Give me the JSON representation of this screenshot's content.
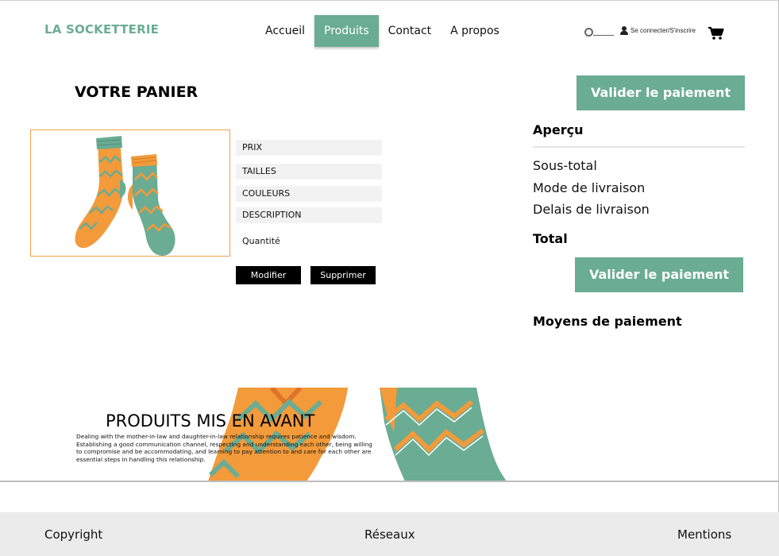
{
  "header": {
    "logo": "LA SOCKETTERIE",
    "nav": [
      "Accueil",
      "Produits",
      "Contact",
      "A propos"
    ],
    "active_nav": "Produits",
    "login_label": "Se connecter/S'inscrire"
  },
  "cart": {
    "title": "VOTRE PANIER",
    "item": {
      "price_label": "PRIX",
      "sizes_label": "TAILLES",
      "colors_label": "COULEURS",
      "description_label": "DESCRIPTION",
      "quantity_label": "Quantité",
      "edit_label": "Modifier",
      "remove_label": "Supprimer"
    }
  },
  "summary": {
    "pay_button": "Valider le paiement",
    "overview_title": "Aperçu",
    "subtotal": "Sous-total",
    "delivery_mode": "Mode de livraison",
    "delivery_time": "Delais de livraison",
    "total": "Total",
    "payment_methods": "Moyens de paiement"
  },
  "featured": {
    "title": "PRODUITS MIS EN AVANT",
    "text": "Dealing with the mother-in-law and daughter-in-law relationship requires patience and wisdom. Establishing a good communication channel, respecting and understanding each other, being willing to compromise and be accommodating, and learning to pay attention to and care for each other are essential steps in handling this relationship."
  },
  "footer": {
    "copyright": "Copyright",
    "social": "Réseaux",
    "legal": "Mentions"
  },
  "colors": {
    "brand": "#6aac94",
    "accent": "#f4a24a",
    "dark": "#000000"
  },
  "icons": [
    "search-icon",
    "user-icon",
    "cart-icon"
  ]
}
